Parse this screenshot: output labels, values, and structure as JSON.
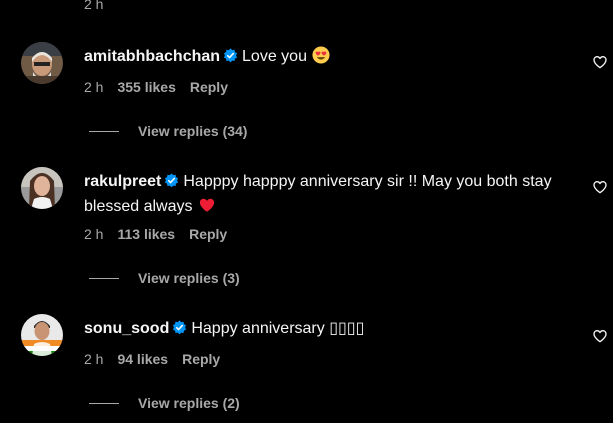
{
  "top": {
    "time": "2 h"
  },
  "comments": [
    {
      "username": "amitabhbachchan",
      "text": "Love you",
      "emoji": "heart-eyes-emoji",
      "time": "2 h",
      "likes": "355 likes",
      "reply": "Reply",
      "view_replies": "View replies (34)"
    },
    {
      "username": "rakulpreet",
      "text": "Happpy happpy anniversary sir !! May you both stay blessed always",
      "emoji": "red-heart-emoji",
      "time": "2 h",
      "likes": "113 likes",
      "reply": "Reply",
      "view_replies": "View replies (3)"
    },
    {
      "username": "sonu_sood",
      "text": "Happy anniversary ▯▯▯▯",
      "time": "2 h",
      "likes": "94 likes",
      "reply": "Reply",
      "view_replies": "View replies (2)"
    }
  ],
  "colors": {
    "background": "#000000",
    "primary_text": "#f5f5f5",
    "secondary_text": "#a8a8a8",
    "verified": "#0095f6",
    "heart": "#ed1d36"
  }
}
